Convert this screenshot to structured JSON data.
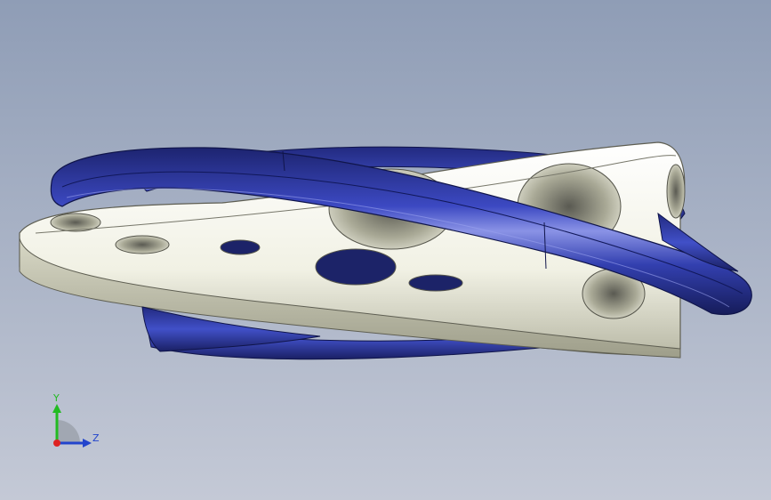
{
  "viewport": {
    "background_top": "#8f9db6",
    "background_bottom": "#c4c9d6"
  },
  "model": {
    "blue_part_color": "#2e3a9e",
    "white_part_color": "#f3f3e8"
  },
  "triad": {
    "y_label": "Y",
    "z_label": "Z",
    "y_color": "#22bb22",
    "z_color": "#2244cc",
    "x_color": "#dd2222"
  }
}
